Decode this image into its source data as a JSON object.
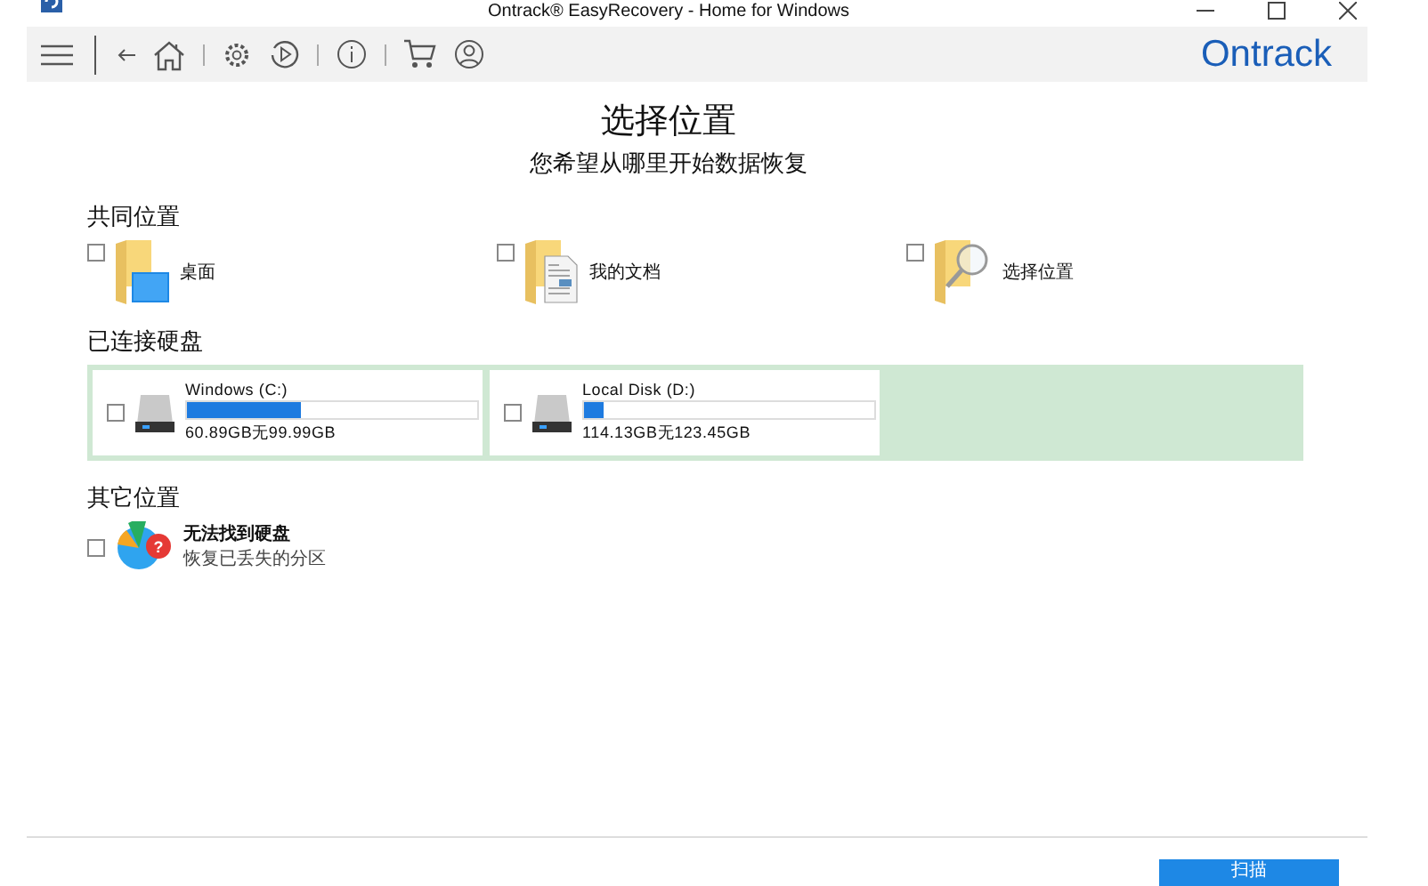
{
  "window": {
    "title": "Ontrack® EasyRecovery - Home for Windows"
  },
  "brand": "Ontrack",
  "heading": "选择位置",
  "subheading": "您希望从哪里开始数据恢复",
  "common": {
    "title": "共同位置",
    "items": [
      {
        "kind": "desktop",
        "label": "桌面",
        "checked": false
      },
      {
        "kind": "documents",
        "label": "我的文档",
        "checked": false
      },
      {
        "kind": "browse",
        "label": "选择位置",
        "checked": false
      }
    ]
  },
  "drives": {
    "title": "已连接硬盘",
    "items": [
      {
        "name": "Windows (C:)",
        "level": 0.39,
        "usage": "60.89GB无99.99GB",
        "checked": false
      },
      {
        "name": "Local Disk (D:)",
        "level": 0.07,
        "usage": "114.13GB无123.45GB",
        "checked": false
      }
    ]
  },
  "other": {
    "title": "其它位置",
    "items": [
      {
        "badge": "?",
        "title": "无法找到硬盘",
        "subtitle": "恢复已丢失的分区",
        "checked": false
      }
    ]
  },
  "scan_button": "扫描"
}
